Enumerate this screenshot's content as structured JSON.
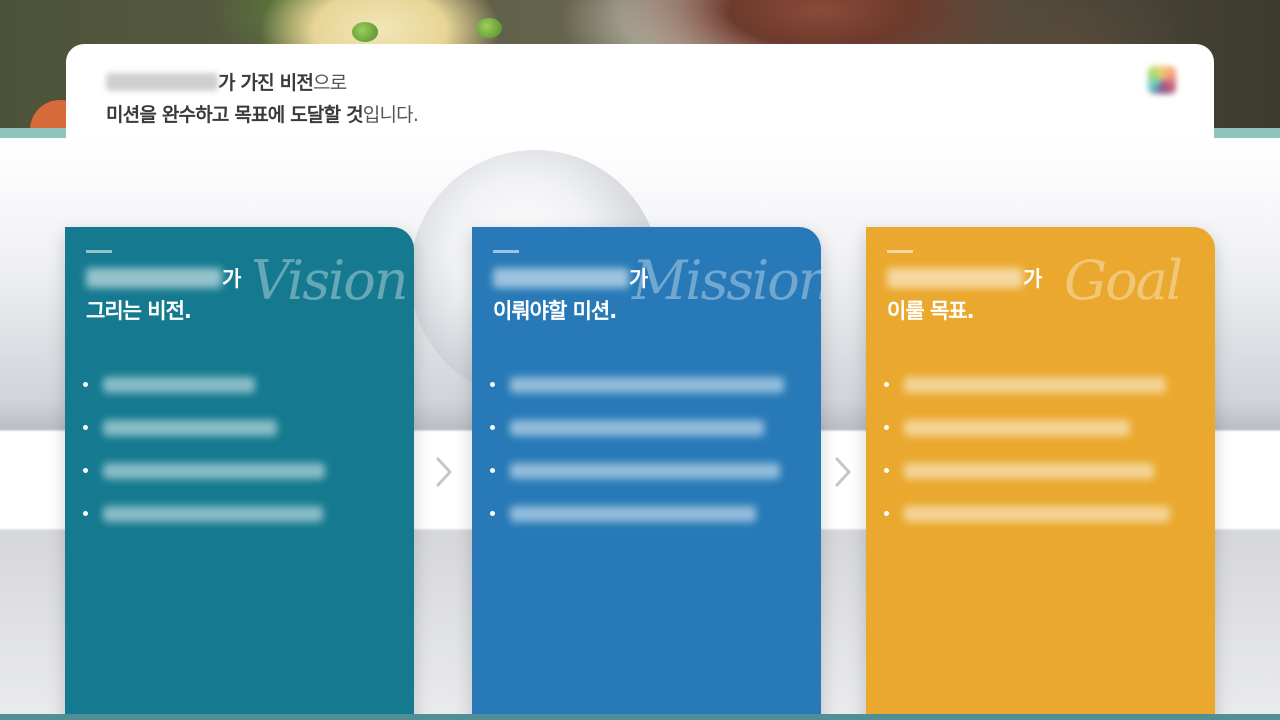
{
  "header": {
    "line1_suffix_bold": "가 가진 비전",
    "line1_suffix_normal": "으로",
    "line2_bold": "미션을 완수하고 목표에 도달할 것",
    "line2_normal": "입니다."
  },
  "cards": [
    {
      "key": "vision",
      "color": "#157a8f",
      "script_word": "Vision",
      "title_suffix": "가",
      "title_line2": "그리는 비전.",
      "bullet_count": 4
    },
    {
      "key": "mission",
      "color": "#277ab7",
      "script_word": "Mission",
      "title_suffix": "가",
      "title_line2": "이뤄야할 미션.",
      "bullet_count": 4
    },
    {
      "key": "goal",
      "color": "#eaa92e",
      "script_word": "Goal",
      "title_suffix": "가",
      "title_line2": "이룰 목표.",
      "bullet_count": 4
    }
  ],
  "colors": {
    "teal_strip": "#8ec3bf",
    "bottom_line": "#4f8f95",
    "arrow": "#c4c6cc"
  },
  "icons": {
    "next": "chevron-right-icon",
    "bullet": "bullet-dot-icon"
  }
}
